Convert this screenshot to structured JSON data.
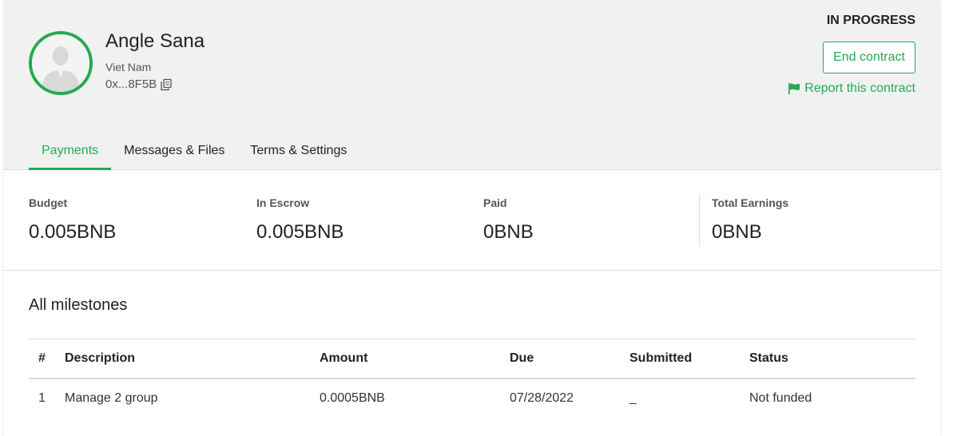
{
  "contract": {
    "user_name": "Angle Sana",
    "country": "Viet Nam",
    "address": "0x...8F5B",
    "status": "IN PROGRESS",
    "end_label": "End contract",
    "report_label": "Report this contract"
  },
  "tabs": [
    {
      "label": "Payments",
      "active": true
    },
    {
      "label": "Messages & Files",
      "active": false
    },
    {
      "label": "Terms & Settings",
      "active": false
    }
  ],
  "stats": [
    {
      "label": "Budget",
      "value": "0.005BNB"
    },
    {
      "label": "In Escrow",
      "value": "0.005BNB"
    },
    {
      "label": "Paid",
      "value": "0BNB"
    },
    {
      "label": "Total Earnings",
      "value": "0BNB"
    }
  ],
  "milestones": {
    "title": "All milestones",
    "columns": [
      "#",
      "Description",
      "Amount",
      "Due",
      "Submitted",
      "Status"
    ],
    "rows": [
      [
        "1",
        "Manage 2 group",
        "0.0005BNB",
        "07/28/2022",
        "_",
        "Not funded"
      ]
    ]
  },
  "icons": {
    "avatar": "user-avatar-icon",
    "copy": "copy-icon",
    "report": "flag-icon"
  },
  "colors": {
    "accent": "#27a855",
    "header_bg": "#f1f1f1"
  }
}
